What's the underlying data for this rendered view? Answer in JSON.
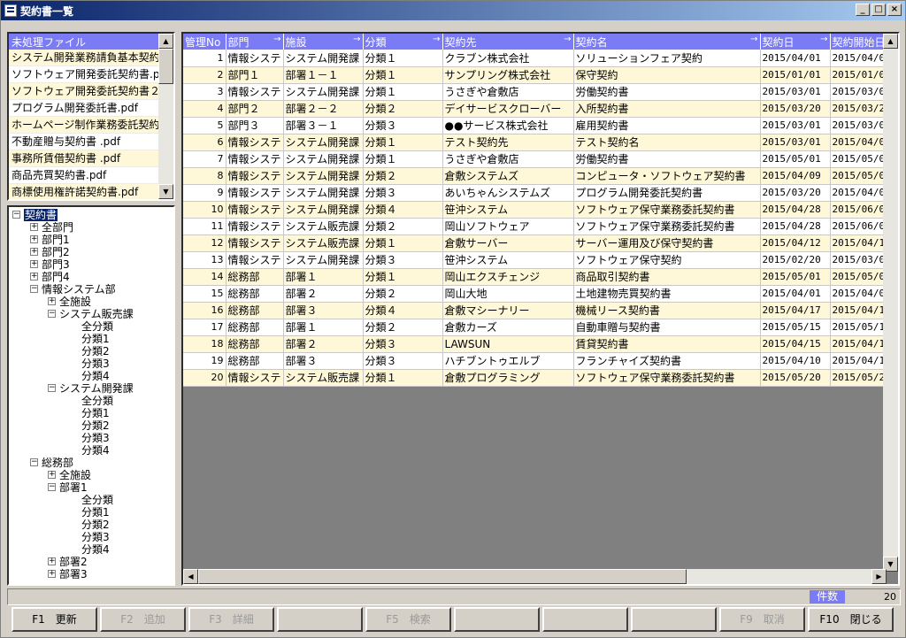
{
  "window": {
    "title": "契約書一覧"
  },
  "file_list": {
    "header": "未処理ファイル",
    "items": [
      "システム開発業務請負基本契約",
      "ソフトウェア開発委託契約書.p",
      "ソフトウェア開発委託契約書２",
      "プログラム開発委託書.pdf",
      "ホームページ制作業務委託契約",
      "不動産贈与契約書 .pdf",
      "事務所賃借契約書 .pdf",
      "商品売買契約書.pdf",
      "商標使用権許諾契約書.pdf"
    ]
  },
  "tree": {
    "nodes": [
      {
        "label": "契約書",
        "level": 0,
        "box": "-",
        "selected": true
      },
      {
        "label": "全部門",
        "level": 1,
        "box": "+"
      },
      {
        "label": "部門1",
        "level": 1,
        "box": "+"
      },
      {
        "label": "部門2",
        "level": 1,
        "box": "+"
      },
      {
        "label": "部門3",
        "level": 1,
        "box": "+"
      },
      {
        "label": "部門4",
        "level": 1,
        "box": "+"
      },
      {
        "label": "情報システム部",
        "level": 1,
        "box": "-"
      },
      {
        "label": "全施設",
        "level": 2,
        "box": "+"
      },
      {
        "label": "システム販売課",
        "level": 2,
        "box": "-"
      },
      {
        "label": "全分類",
        "level": 3,
        "box": ""
      },
      {
        "label": "分類1",
        "level": 3,
        "box": ""
      },
      {
        "label": "分類2",
        "level": 3,
        "box": ""
      },
      {
        "label": "分類3",
        "level": 3,
        "box": ""
      },
      {
        "label": "分類4",
        "level": 3,
        "box": ""
      },
      {
        "label": "システム開発課",
        "level": 2,
        "box": "-"
      },
      {
        "label": "全分類",
        "level": 3,
        "box": ""
      },
      {
        "label": "分類1",
        "level": 3,
        "box": ""
      },
      {
        "label": "分類2",
        "level": 3,
        "box": ""
      },
      {
        "label": "分類3",
        "level": 3,
        "box": ""
      },
      {
        "label": "分類4",
        "level": 3,
        "box": ""
      },
      {
        "label": "総務部",
        "level": 1,
        "box": "-"
      },
      {
        "label": "全施設",
        "level": 2,
        "box": "+"
      },
      {
        "label": "部署1",
        "level": 2,
        "box": "-"
      },
      {
        "label": "全分類",
        "level": 3,
        "box": ""
      },
      {
        "label": "分類1",
        "level": 3,
        "box": ""
      },
      {
        "label": "分類2",
        "level": 3,
        "box": ""
      },
      {
        "label": "分類3",
        "level": 3,
        "box": ""
      },
      {
        "label": "分類4",
        "level": 3,
        "box": ""
      },
      {
        "label": "部署2",
        "level": 2,
        "box": "+"
      },
      {
        "label": "部署3",
        "level": 2,
        "box": "+"
      }
    ]
  },
  "grid": {
    "columns": [
      "管理No",
      "部門",
      "施設",
      "分類",
      "契約先",
      "契約名",
      "契約日",
      "契約開始日"
    ],
    "rows": [
      [
        "1",
        "情報システ",
        "システム開発課",
        "分類１",
        "クラブン株式会社",
        "ソリューションフェア契約",
        "2015/04/01",
        "2015/04/0"
      ],
      [
        "2",
        "部門１",
        "部署１－１",
        "分類１",
        "サンプリング株式会社",
        "保守契約",
        "2015/01/01",
        "2015/01/0"
      ],
      [
        "3",
        "情報システ",
        "システム開発課",
        "分類１",
        "うさぎや倉敷店",
        "労働契約書",
        "2015/03/01",
        "2015/03/0"
      ],
      [
        "4",
        "部門２",
        "部署２－２",
        "分類２",
        "デイサービスクローバー",
        "入所契約書",
        "2015/03/20",
        "2015/03/2"
      ],
      [
        "5",
        "部門３",
        "部署３－１",
        "分類３",
        "●●サービス株式会社",
        "雇用契約書",
        "2015/03/01",
        "2015/03/0"
      ],
      [
        "6",
        "情報システ",
        "システム開発課",
        "分類１",
        "テスト契約先",
        "テスト契約名",
        "2015/03/01",
        "2015/04/0"
      ],
      [
        "7",
        "情報システ",
        "システム開発課",
        "分類１",
        "うさぎや倉敷店",
        "労働契約書",
        "2015/05/01",
        "2015/05/0"
      ],
      [
        "8",
        "情報システ",
        "システム開発課",
        "分類２",
        "倉敷システムズ",
        "コンピュータ・ソフトウェア契約書",
        "2015/04/09",
        "2015/05/0"
      ],
      [
        "9",
        "情報システ",
        "システム開発課",
        "分類３",
        "あいちゃんシステムズ",
        "プログラム開発委託契約書",
        "2015/03/20",
        "2015/04/0"
      ],
      [
        "10",
        "情報システ",
        "システム開発課",
        "分類４",
        "笹沖システム",
        "ソフトウェア保守業務委託契約書",
        "2015/04/28",
        "2015/06/0"
      ],
      [
        "11",
        "情報システ",
        "システム販売課",
        "分類２",
        "岡山ソフトウェア",
        "ソフトウェア保守業務委託契約書",
        "2015/04/28",
        "2015/06/0"
      ],
      [
        "12",
        "情報システ",
        "システム販売課",
        "分類１",
        "倉敷サーバー",
        "サーバー運用及び保守契約書",
        "2015/04/12",
        "2015/04/1"
      ],
      [
        "13",
        "情報システ",
        "システム開発課",
        "分類３",
        "笹沖システム",
        "ソフトウェア保守契約",
        "2015/02/20",
        "2015/03/0"
      ],
      [
        "14",
        "総務部",
        "部署１",
        "分類１",
        "岡山エクスチェンジ",
        "商品取引契約書",
        "2015/05/01",
        "2015/05/0"
      ],
      [
        "15",
        "総務部",
        "部署２",
        "分類２",
        "岡山大地",
        "土地建物売買契約書",
        "2015/04/01",
        "2015/04/0"
      ],
      [
        "16",
        "総務部",
        "部署３",
        "分類４",
        "倉敷マシーナリー",
        "機械リース契約書",
        "2015/04/17",
        "2015/04/1"
      ],
      [
        "17",
        "総務部",
        "部署１",
        "分類２",
        "倉敷カーズ",
        "自動車贈与契約書",
        "2015/05/15",
        "2015/05/1"
      ],
      [
        "18",
        "総務部",
        "部署２",
        "分類３",
        "LAWSUN",
        "賃貸契約書",
        "2015/04/15",
        "2015/04/1"
      ],
      [
        "19",
        "総務部",
        "部署３",
        "分類３",
        "ハチブントゥエルブ",
        "フランチャイズ契約書",
        "2015/04/10",
        "2015/04/1"
      ],
      [
        "20",
        "情報システ",
        "システム販売課",
        "分類１",
        "倉敷プログラミング",
        "ソフトウェア保守業務委託契約書",
        "2015/05/20",
        "2015/05/2"
      ]
    ]
  },
  "status": {
    "count_label": "件数",
    "count_value": "20"
  },
  "fkeys": [
    {
      "label": "F1　更新",
      "enabled": true
    },
    {
      "label": "F2　追加",
      "enabled": false
    },
    {
      "label": "F3　詳細",
      "enabled": false
    },
    {
      "label": "",
      "enabled": false
    },
    {
      "label": "F5　検索",
      "enabled": false
    },
    {
      "label": "",
      "enabled": false
    },
    {
      "label": "",
      "enabled": false
    },
    {
      "label": "",
      "enabled": false
    },
    {
      "label": "F9　取消",
      "enabled": false
    },
    {
      "label": "F10　閉じる",
      "enabled": true
    }
  ]
}
